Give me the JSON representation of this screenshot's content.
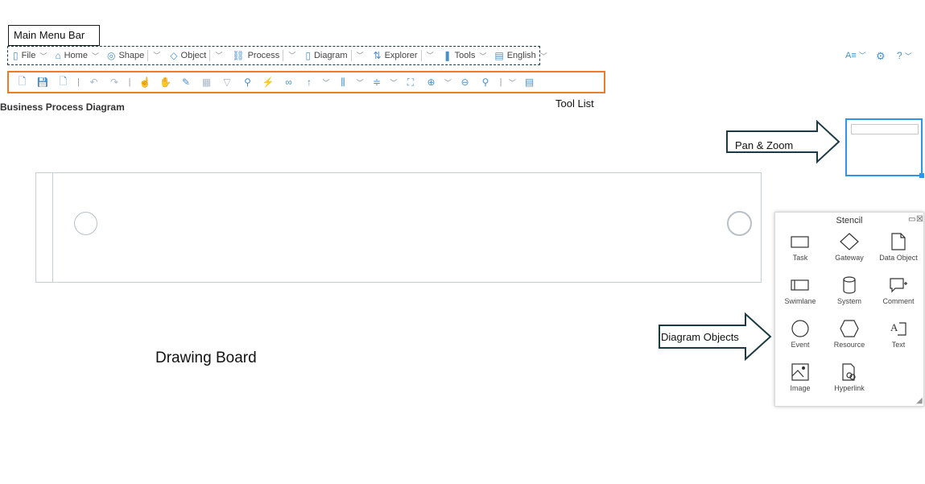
{
  "callouts": {
    "main_menu_bar": "Main Menu Bar",
    "tool_list": "Tool List",
    "pan_zoom": "Pan & Zoom",
    "diagram_objects": "Diagram Objects",
    "drawing_board": "Drawing Board"
  },
  "menu": [
    {
      "label": "File",
      "icon": "file-icon"
    },
    {
      "label": "Home",
      "icon": "home-icon"
    },
    {
      "label": "Shape",
      "icon": "shape-icon"
    },
    {
      "label": "Object",
      "icon": "object-icon"
    },
    {
      "label": "Process",
      "icon": "process-icon"
    },
    {
      "label": "Diagram",
      "icon": "diagram-icon"
    },
    {
      "label": "Explorer",
      "icon": "explorer-icon"
    },
    {
      "label": "Tools",
      "icon": "tools-icon"
    },
    {
      "label": "English",
      "icon": "language-icon"
    }
  ],
  "page_title": "Business Process Diagram",
  "topright": {
    "translate_icon": "A≡",
    "settings_icon": "gear-icon",
    "help": "?"
  },
  "stencil": {
    "title": "Stencil",
    "items": [
      "Task",
      "Gateway",
      "Data Object",
      "Swimlane",
      "System",
      "Comment",
      "Event",
      "Resource",
      "Text",
      "Image",
      "Hyperlink"
    ]
  },
  "colors": {
    "accent": "#4a90c8",
    "toolbar_border": "#f07a2a",
    "panzoom_border": "#2f95e6"
  }
}
